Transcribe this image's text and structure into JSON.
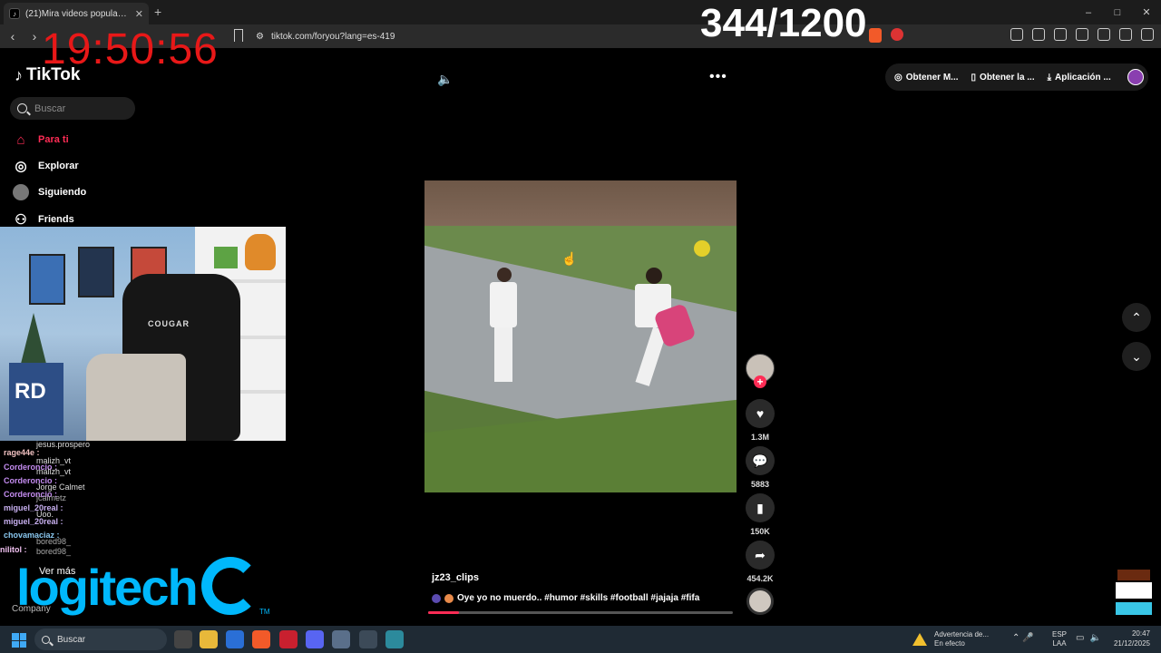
{
  "browser": {
    "tab_title": "(21)Mira videos populares se",
    "tab_favicon": "tiktok-icon",
    "new_tab": "+",
    "url": "tiktok.com/foryou?lang=es-419",
    "window_controls": [
      "–",
      "□",
      "✕"
    ]
  },
  "overlay": {
    "clock": "19:50:56",
    "counter": "344/1200",
    "clock_color": "#e81818"
  },
  "tiktok": {
    "logo": "TikTok",
    "search_placeholder": "Buscar",
    "nav": [
      {
        "label": "Para ti",
        "icon": "home-icon",
        "active": true
      },
      {
        "label": "Explorar",
        "icon": "compass-icon"
      },
      {
        "label": "Siguiendo",
        "icon": "following-avatar-icon"
      },
      {
        "label": "Friends",
        "icon": "friends-icon"
      }
    ],
    "top_actions": [
      {
        "label": "Obtener M...",
        "icon": "coin-icon"
      },
      {
        "label": "Obtener la ...",
        "icon": "phone-icon"
      },
      {
        "label": "Aplicación ...",
        "icon": "download-icon"
      }
    ],
    "accent": "#fe2c55"
  },
  "video": {
    "creator": "jz23_clips",
    "description": "Oye yo no muerdo.. #humor #skills #football #jajaja #fifa",
    "likes": "1.3M",
    "comments": "5883",
    "saves": "150K",
    "shares": "454.2K",
    "progress": 0.1
  },
  "chat": [
    {
      "user": "",
      "text": "jesus.prospero"
    },
    {
      "user": "rage44e :",
      "text": ""
    },
    {
      "user": "",
      "text": "malizh_vt"
    },
    {
      "user": "Corderoncio :",
      "text": ""
    },
    {
      "user": "",
      "text": "malizh_vt"
    },
    {
      "user": "Corderoncio :",
      "text": ""
    },
    {
      "user": "",
      "text": "Jorge Calmet"
    },
    {
      "user": "Corderoncio :",
      "text": ""
    },
    {
      "user": "",
      "text": "jcalmetz"
    },
    {
      "user": "miguel_20real :",
      "text": ""
    },
    {
      "user": "",
      "text": "Uoo."
    },
    {
      "user": "miguel_20real :",
      "text": ""
    },
    {
      "user": "chovamaciaz :",
      "text": ""
    },
    {
      "user": "",
      "text": "bored98_"
    },
    {
      "user": "nilitol :",
      "text": ""
    },
    {
      "user": "",
      "text": "bored98_"
    }
  ],
  "webcam": {
    "chair_brand": "COUGAR",
    "box_text": "RD"
  },
  "sponsor": {
    "ver_mas": "Ver más",
    "logo": "logitech",
    "tm": "TM",
    "company": "Company"
  },
  "taskbar": {
    "search": "Buscar",
    "warning_title": "Advertencia de...",
    "warning_sub": "En efecto",
    "lang1": "ESP",
    "lang2": "LAA",
    "time": "20:47",
    "date": "21/12/2025"
  }
}
